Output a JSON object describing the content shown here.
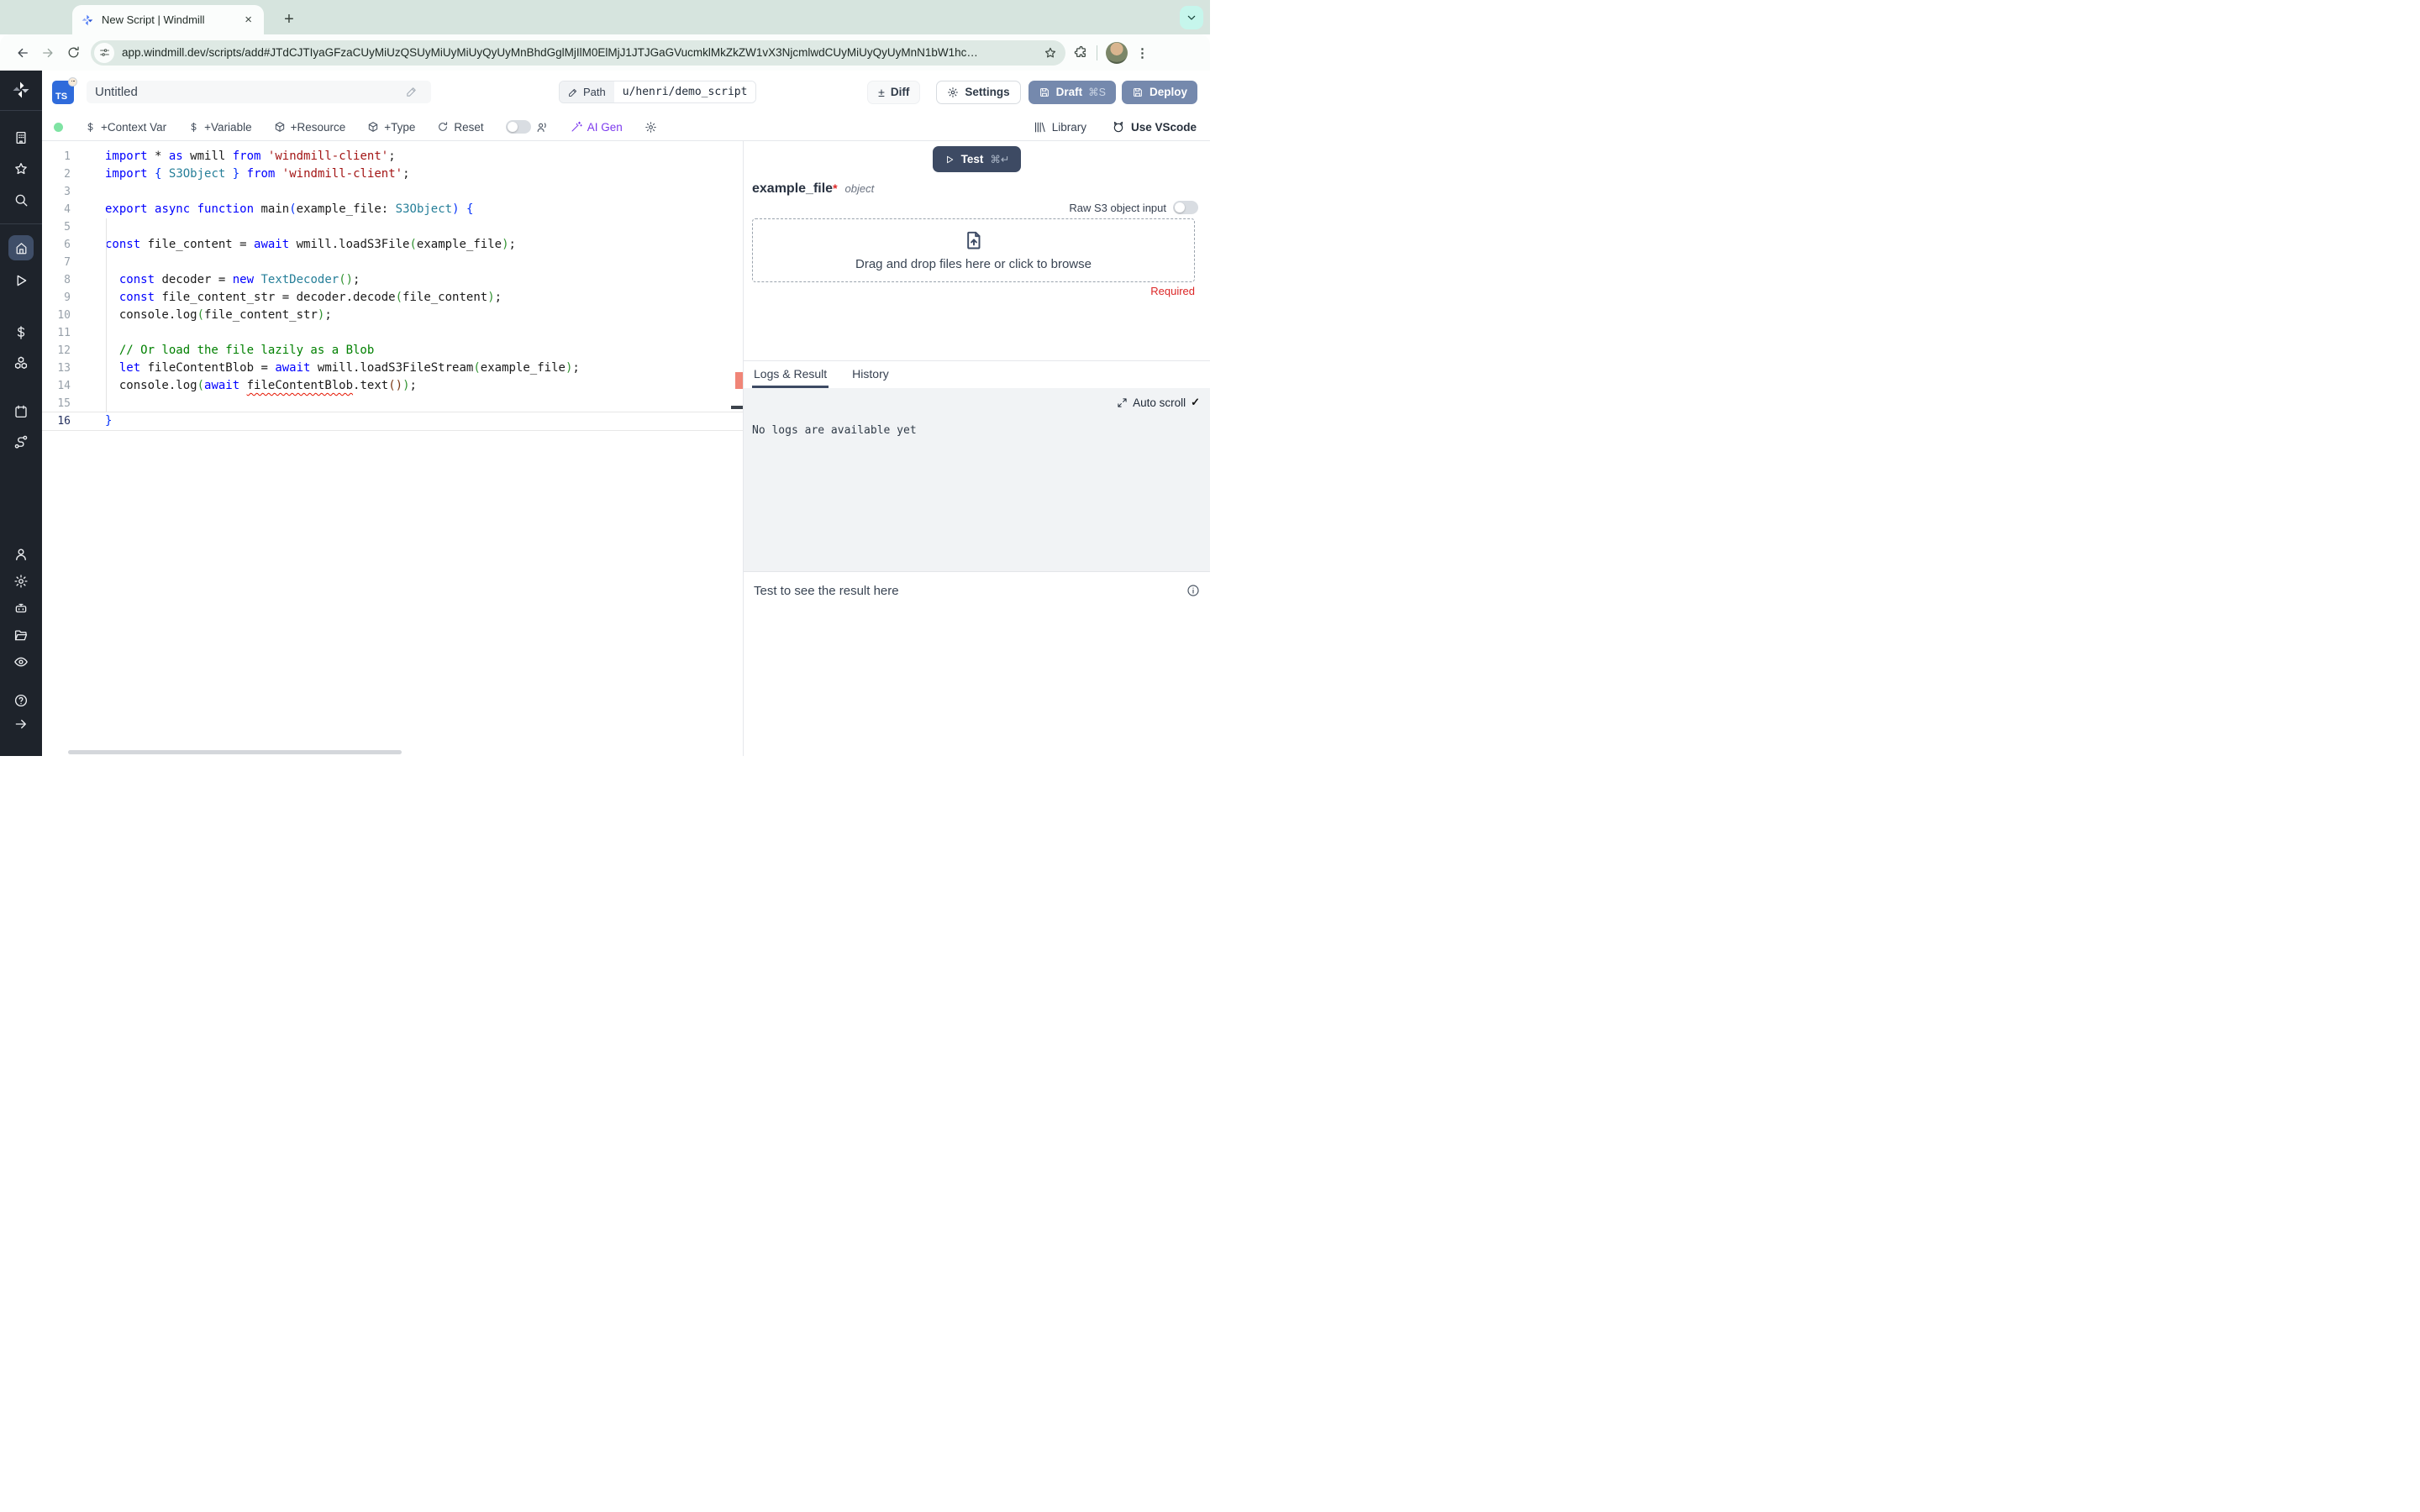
{
  "browser": {
    "tab_title": "New Script | Windmill",
    "url": "app.windmill.dev/scripts/add#JTdCJTIyaGFzaCUyMiUzQSUyMiUyMiUyQyUyMnBhdGglMjIlM0ElMjJ1JTJGaGVucmklMkZkZW1vX3NjcmlwdCUyMiUyQyUyMnN1bW1hc…"
  },
  "sidebar": {
    "icons": [
      "windmill-logo",
      "building",
      "star",
      "search",
      "home",
      "play",
      "dollar",
      "cubes",
      "calendar",
      "route",
      "person",
      "gear",
      "robot",
      "folder",
      "eye",
      "help",
      "arrow-right"
    ]
  },
  "header": {
    "language_badge": "TS",
    "title": "Untitled",
    "path_label": "Path",
    "path_value": "u/henri/demo_script",
    "diff_label": "Diff",
    "diff_sign": "±",
    "settings_label": "Settings",
    "draft_label": "Draft",
    "draft_shortcut": "⌘S",
    "deploy_label": "Deploy"
  },
  "toolbar": {
    "context_var": "+Context Var",
    "variable": "+Variable",
    "resource": "+Resource",
    "type": "+Type",
    "reset": "Reset",
    "ai_gen": "AI Gen",
    "library": "Library",
    "use_vscode": "Use VScode"
  },
  "editor": {
    "active_line": 16,
    "lines": [
      [
        [
          "kw",
          "import"
        ],
        [
          "pl",
          " * "
        ],
        [
          "kw",
          "as"
        ],
        [
          "pl",
          " wmill "
        ],
        [
          "kw",
          "from"
        ],
        [
          "pl",
          " "
        ],
        [
          "str",
          "'windmill-client'"
        ],
        [
          "pl",
          ";"
        ]
      ],
      [
        [
          "kw",
          "import"
        ],
        [
          "pl",
          " "
        ],
        [
          "b1",
          "{"
        ],
        [
          "pl",
          " "
        ],
        [
          "type",
          "S3Object"
        ],
        [
          "pl",
          " "
        ],
        [
          "b1",
          "}"
        ],
        [
          "pl",
          " "
        ],
        [
          "kw",
          "from"
        ],
        [
          "pl",
          " "
        ],
        [
          "str",
          "'windmill-client'"
        ],
        [
          "pl",
          ";"
        ]
      ],
      [],
      [
        [
          "kw",
          "export"
        ],
        [
          "pl",
          " "
        ],
        [
          "kw",
          "async"
        ],
        [
          "pl",
          " "
        ],
        [
          "kw",
          "function"
        ],
        [
          "pl",
          " main"
        ],
        [
          "b1",
          "("
        ],
        [
          "pl",
          "example_file: "
        ],
        [
          "type",
          "S3Object"
        ],
        [
          "b1",
          ")"
        ],
        [
          "pl",
          " "
        ],
        [
          "b1",
          "{"
        ]
      ],
      [],
      [
        [
          "kw",
          "const"
        ],
        [
          "pl",
          " file_content = "
        ],
        [
          "kw",
          "await"
        ],
        [
          "pl",
          " wmill.loadS3File"
        ],
        [
          "b2",
          "("
        ],
        [
          "pl",
          "example_file"
        ],
        [
          "b2",
          ")"
        ],
        [
          "pl",
          ";"
        ]
      ],
      [],
      [
        [
          "pl",
          "  "
        ],
        [
          "kw",
          "const"
        ],
        [
          "pl",
          " decoder = "
        ],
        [
          "kw",
          "new"
        ],
        [
          "pl",
          " "
        ],
        [
          "type",
          "TextDecoder"
        ],
        [
          "b2",
          "()"
        ],
        [
          "pl",
          ";"
        ]
      ],
      [
        [
          "pl",
          "  "
        ],
        [
          "kw",
          "const"
        ],
        [
          "pl",
          " file_content_str = decoder.decode"
        ],
        [
          "b2",
          "("
        ],
        [
          "pl",
          "file_content"
        ],
        [
          "b2",
          ")"
        ],
        [
          "pl",
          ";"
        ]
      ],
      [
        [
          "pl",
          "  console.log"
        ],
        [
          "b2",
          "("
        ],
        [
          "pl",
          "file_content_str"
        ],
        [
          "b2",
          ")"
        ],
        [
          "pl",
          ";"
        ]
      ],
      [],
      [
        [
          "cmt",
          "  // Or load the file lazily as a Blob"
        ]
      ],
      [
        [
          "pl",
          "  "
        ],
        [
          "kw",
          "let"
        ],
        [
          "pl",
          " fileContentBlob = "
        ],
        [
          "kw",
          "await"
        ],
        [
          "pl",
          " wmill.loadS3FileStream"
        ],
        [
          "b2",
          "("
        ],
        [
          "pl",
          "example_file"
        ],
        [
          "b2",
          ")"
        ],
        [
          "pl",
          ";"
        ]
      ],
      [
        [
          "pl",
          "  console.log"
        ],
        [
          "b2",
          "("
        ],
        [
          "kw",
          "await"
        ],
        [
          "pl",
          " "
        ],
        [
          "sq",
          "fileContentBlob"
        ],
        [
          "pl",
          ".text"
        ],
        [
          "b3",
          "()"
        ],
        [
          "b2",
          ")"
        ],
        [
          "pl",
          ";"
        ]
      ],
      [],
      [
        [
          "b1",
          "}"
        ]
      ]
    ]
  },
  "right_panel": {
    "test_label": "Test",
    "test_shortcut": "⌘↵",
    "arg_name": "example_file",
    "arg_required_star": "*",
    "arg_type": "object",
    "raw_s3_label": "Raw S3 object input",
    "dropzone_text": "Drag and drop files here or click to browse",
    "required_text": "Required",
    "tab_logs": "Logs & Result",
    "tab_history": "History",
    "auto_scroll_label": "Auto scroll",
    "auto_scroll_check": "✓",
    "no_logs_text": "No logs are available yet",
    "result_placeholder": "Test to see the result here"
  },
  "colors": {
    "chrome_strip": "#d6e4de",
    "chrome_surface": "#fbfdfc",
    "omnibox": "#dee9e4",
    "mint_button": "#c6f6ec",
    "sidebar_bg": "#1e232b",
    "sidebar_active": "#3f4e68",
    "slate_button": "#7589ad",
    "test_button": "#3d4a63",
    "ai_gen_purple": "#7c3aed",
    "status_green": "#7fe3a3",
    "error_red": "#dc2626",
    "squiggle_red": "#e51400"
  }
}
